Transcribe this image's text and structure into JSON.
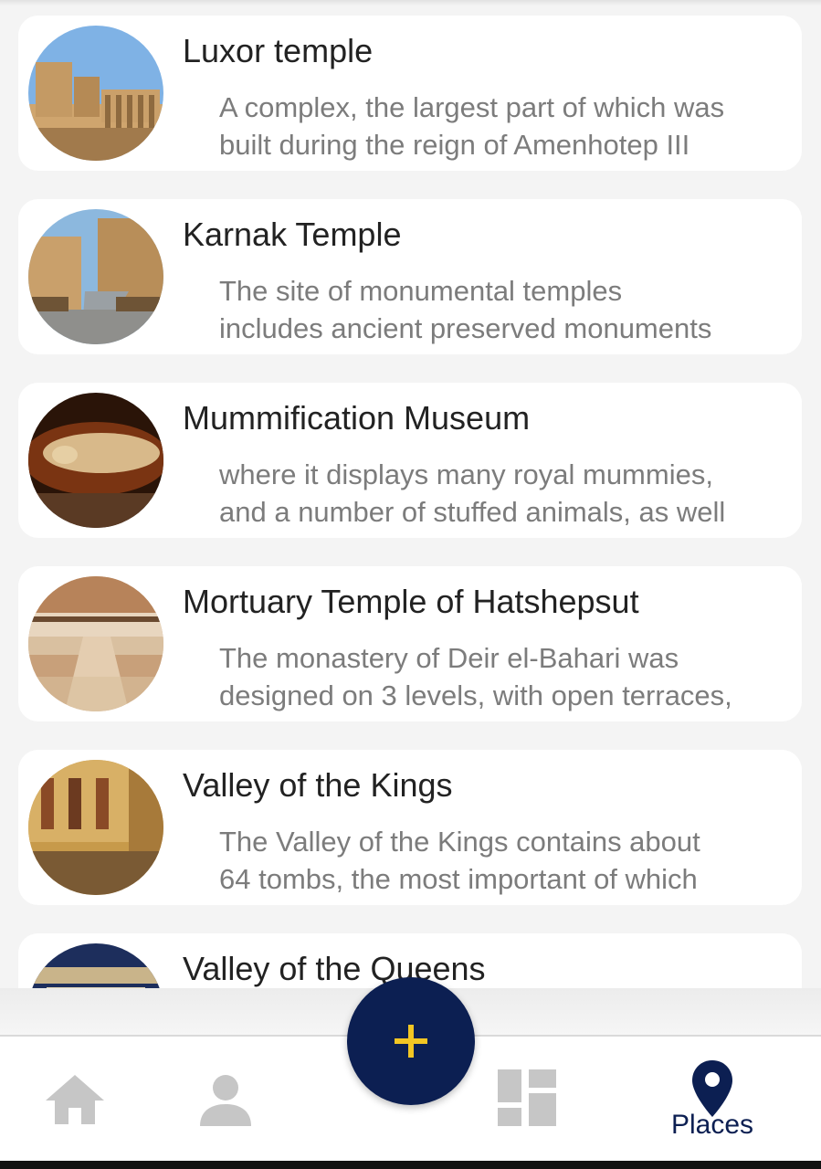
{
  "colors": {
    "accent": "#0c1f52",
    "fab_icon": "#f3c623",
    "inactive_icon": "#c6c6c6",
    "title_text": "#222222",
    "desc_text": "#7c7c7c"
  },
  "places": [
    {
      "title": "Luxor temple",
      "desc_line1": "A complex, the largest part of which was",
      "desc_line2": "built during the reign of Amenhotep III",
      "image": "luxor-temple-photo"
    },
    {
      "title": "Karnak Temple",
      "desc_line1": "The site of monumental temples",
      "desc_line2": "includes ancient preserved monuments",
      "image": "karnak-temple-photo"
    },
    {
      "title": "Mummification Museum",
      "desc_line1": "where it displays many royal mummies,",
      "desc_line2": "and a number of stuffed animals, as well",
      "image": "mummy-sarcophagus-photo"
    },
    {
      "title": "Mortuary Temple of Hatshepsut",
      "desc_line1": "The monastery of Deir el-Bahari was",
      "desc_line2": "designed on 3 levels, with open terraces,",
      "image": "hatshepsut-temple-photo"
    },
    {
      "title": "Valley of the Kings",
      "desc_line1": "The Valley of the Kings contains about",
      "desc_line2": "64 tombs, the most important of which",
      "image": "tomb-painting-photo"
    },
    {
      "title": "Valley of the Queens",
      "desc_line1": "",
      "desc_line2": "",
      "image": "tomb-ceiling-photo"
    }
  ],
  "fab": {
    "icon": "plus-icon"
  },
  "nav": {
    "home_icon": "home-icon",
    "profile_icon": "person-icon",
    "dashboard_icon": "dashboard-icon",
    "places_icon": "map-pin-icon",
    "places_label": "Places"
  }
}
